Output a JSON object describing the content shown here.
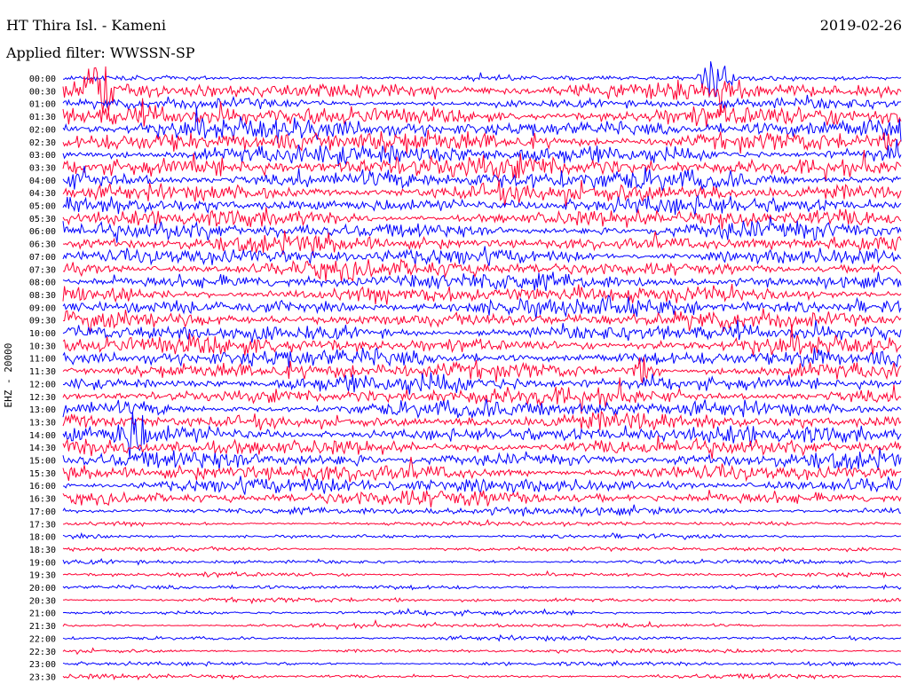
{
  "header": {
    "station": "HT Thira Isl. - Kameni",
    "date": "2019-02-26",
    "filter_label": "Applied filter: WWSSN-SP"
  },
  "channel_label": "EHZ - 20000",
  "colors": {
    "trace_a": "#0000ff",
    "trace_b": "#ff0033",
    "text": "#000000",
    "background": "#ffffff"
  },
  "chart_data": {
    "type": "line",
    "kind": "helicorder",
    "title": "HT Thira Isl. - Kameni",
    "date": "2019-02-26",
    "filter": "WWSSN-SP",
    "ylabel": "EHZ - 20000",
    "row_duration_minutes": 30,
    "x_range_minutes": [
      0,
      30
    ],
    "row_labels": [
      "00:00",
      "00:30",
      "01:00",
      "01:30",
      "02:00",
      "02:30",
      "03:00",
      "03:30",
      "04:00",
      "04:30",
      "05:00",
      "05:30",
      "06:00",
      "06:30",
      "07:00",
      "07:30",
      "08:00",
      "08:30",
      "09:00",
      "09:30",
      "10:00",
      "10:30",
      "11:00",
      "11:30",
      "12:00",
      "12:30",
      "13:00",
      "13:30",
      "14:00",
      "14:30",
      "15:00",
      "15:30",
      "16:00",
      "16:30",
      "17:00",
      "17:30",
      "18:00",
      "18:30",
      "19:00",
      "19:30",
      "20:00",
      "20:30",
      "21:00",
      "21:30",
      "22:00",
      "22:30",
      "23:00",
      "23:30"
    ],
    "series": [
      {
        "color": "#0000ff",
        "rows": "even (00:00, 01:00, ...)"
      },
      {
        "color": "#ff0033",
        "rows": "odd (00:30, 01:30, ...)"
      }
    ],
    "relative_noise_amplitude": [
      0.6,
      2.2,
      1.2,
      2.4,
      2.4,
      2.6,
      2.4,
      2.6,
      2.4,
      2.2,
      2.0,
      2.0,
      2.0,
      2.0,
      2.0,
      2.0,
      2.0,
      2.0,
      2.0,
      2.0,
      2.0,
      2.0,
      2.0,
      2.0,
      2.0,
      2.0,
      2.0,
      2.0,
      2.0,
      2.0,
      1.9,
      1.9,
      1.8,
      1.8,
      1.0,
      0.55,
      0.5,
      0.5,
      0.5,
      0.5,
      0.5,
      0.5,
      0.5,
      0.5,
      0.5,
      0.5,
      0.5,
      0.5
    ],
    "events": [
      {
        "row": "00:30",
        "minute": 1.2,
        "amplitude": 3.5
      },
      {
        "row": "00:00",
        "minute": 23.4,
        "amplitude": 3.0
      },
      {
        "row": "14:00",
        "minute": 2.5,
        "amplitude": 2.5
      },
      {
        "row": "11:30",
        "minute": 20.8,
        "amplitude": 1.2
      },
      {
        "row": "11:00",
        "minute": 26.7,
        "amplitude": 1.2
      }
    ]
  }
}
